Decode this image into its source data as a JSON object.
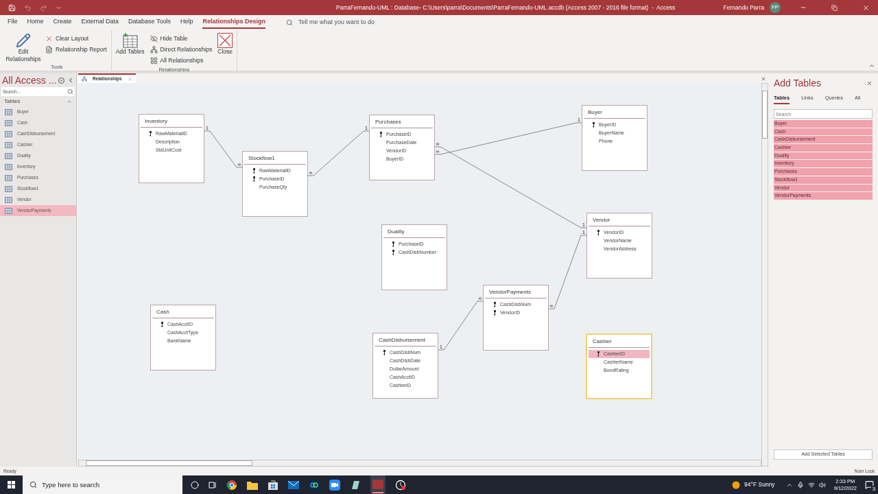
{
  "title_bar": {
    "title": "ParraFernando-UML : Database- C:\\Users\\parra\\Documents\\ParraFernando-UML.accdb (Access 2007 - 2016 file format)  -  Access",
    "user": "Fernando Parra",
    "avatar": "FP"
  },
  "menu_tabs": [
    {
      "label": "File",
      "selected": false
    },
    {
      "label": "Home",
      "selected": false
    },
    {
      "label": "Create",
      "selected": false
    },
    {
      "label": "External Data",
      "selected": false
    },
    {
      "label": "Database Tools",
      "selected": false
    },
    {
      "label": "Help",
      "selected": false
    },
    {
      "label": "Relationships Design",
      "selected": true
    }
  ],
  "tell_me": {
    "placeholder": "Tell me what you want to do"
  },
  "ribbon": {
    "groups": [
      {
        "label": "Tools",
        "buttons": [
          {
            "label": "Edit Relationships",
            "kind": "large"
          },
          {
            "label": "Clear Layout",
            "kind": "small"
          },
          {
            "label": "Relationship Report",
            "kind": "small"
          }
        ]
      },
      {
        "label": "Relationships",
        "buttons": [
          {
            "label": "Add Tables",
            "kind": "large"
          },
          {
            "label": "Hide Table",
            "kind": "small"
          },
          {
            "label": "Direct Relationships",
            "kind": "small"
          },
          {
            "label": "All Relationships",
            "kind": "small"
          },
          {
            "label": "Close",
            "kind": "large"
          }
        ]
      }
    ]
  },
  "nav": {
    "title": "All Access ...",
    "search": {
      "placeholder": "Search..."
    },
    "section": "Tables",
    "items": [
      {
        "label": "Buyer",
        "selected": false
      },
      {
        "label": "Cash",
        "selected": false
      },
      {
        "label": "CashDisbursement",
        "selected": false
      },
      {
        "label": "Cashier",
        "selected": false
      },
      {
        "label": "Duality",
        "selected": false
      },
      {
        "label": "Inventory",
        "selected": false
      },
      {
        "label": "Purchases",
        "selected": false
      },
      {
        "label": "Stockflow1",
        "selected": false
      },
      {
        "label": "Vendor",
        "selected": false
      },
      {
        "label": "VendorPayments",
        "selected": true
      }
    ]
  },
  "document_tab": {
    "label": "Relationships"
  },
  "tables": [
    {
      "name": "Inventory",
      "selected": false,
      "fields": [
        {
          "name": "RawMaterialID",
          "key": true,
          "selected": false
        },
        {
          "name": "Description",
          "key": false,
          "selected": false
        },
        {
          "name": "StdUnitCost",
          "key": false,
          "selected": false
        }
      ]
    },
    {
      "name": "Stockflow1",
      "selected": false,
      "fields": [
        {
          "name": "RawMaterialID",
          "key": true,
          "selected": false
        },
        {
          "name": "PurchaseID",
          "key": true,
          "selected": false
        },
        {
          "name": "PurchaseQty",
          "key": false,
          "selected": false
        }
      ]
    },
    {
      "name": "Purchases",
      "selected": false,
      "fields": [
        {
          "name": "PurchaseID",
          "key": true,
          "selected": false
        },
        {
          "name": "PurchaseDate",
          "key": false,
          "selected": false
        },
        {
          "name": "VendorID",
          "key": false,
          "selected": false
        },
        {
          "name": "BuyerID",
          "key": false,
          "selected": false
        }
      ]
    },
    {
      "name": "Buyer",
      "selected": false,
      "fields": [
        {
          "name": "BuyerID",
          "key": true,
          "selected": false
        },
        {
          "name": "BuyerName",
          "key": false,
          "selected": false
        },
        {
          "name": "Phone",
          "key": false,
          "selected": false
        }
      ]
    },
    {
      "name": "Vendor",
      "selected": false,
      "fields": [
        {
          "name": "VendorID",
          "key": true,
          "selected": false
        },
        {
          "name": "VendorName",
          "key": false,
          "selected": false
        },
        {
          "name": "VendorAddress",
          "key": false,
          "selected": false
        }
      ]
    },
    {
      "name": "Duality",
      "selected": false,
      "fields": [
        {
          "name": "PurchaseID",
          "key": true,
          "selected": false
        },
        {
          "name": "CashDisbNumber",
          "key": true,
          "selected": false
        }
      ]
    },
    {
      "name": "VendorPayments",
      "selected": false,
      "fields": [
        {
          "name": "CashDisbNum",
          "key": true,
          "selected": false
        },
        {
          "name": "VendorID",
          "key": true,
          "selected": false
        }
      ]
    },
    {
      "name": "Cash",
      "selected": false,
      "fields": [
        {
          "name": "CashAcctID",
          "key": true,
          "selected": false
        },
        {
          "name": "CashAcctType",
          "key": false,
          "selected": false
        },
        {
          "name": "BankName",
          "key": false,
          "selected": false
        }
      ]
    },
    {
      "name": "CashDisbursement",
      "selected": false,
      "fields": [
        {
          "name": "CashDisbNum",
          "key": true,
          "selected": false
        },
        {
          "name": "CashDisbDate",
          "key": false,
          "selected": false
        },
        {
          "name": "DollarAmount",
          "key": false,
          "selected": false
        },
        {
          "name": "CashAcctID",
          "key": false,
          "selected": false
        },
        {
          "name": "CashierID",
          "key": false,
          "selected": false
        }
      ]
    },
    {
      "name": "Cashier",
      "selected": true,
      "fields": [
        {
          "name": "CashierID",
          "key": true,
          "selected": true
        },
        {
          "name": "CashierName",
          "key": false,
          "selected": false
        },
        {
          "name": "BondRating",
          "key": false,
          "selected": false
        }
      ]
    }
  ],
  "relationships": [
    {
      "end_a": "1",
      "end_b": "∞"
    },
    {
      "end_a": "∞",
      "end_b": "1"
    },
    {
      "end_a": "∞",
      "end_b": "1"
    },
    {
      "end_a": "∞",
      "end_b": "1"
    },
    {
      "end_a": "1",
      "end_b": "∞"
    },
    {
      "end_a": "∞",
      "end_b": "1"
    }
  ],
  "add_tables": {
    "title": "Add Tables",
    "tabs": [
      {
        "label": "Tables",
        "selected": true
      },
      {
        "label": "Links",
        "selected": false
      },
      {
        "label": "Queries",
        "selected": false
      },
      {
        "label": "All",
        "selected": false
      }
    ],
    "search": {
      "placeholder": "Search"
    },
    "items": [
      {
        "label": "Buyer",
        "selected": true
      },
      {
        "label": "Cash",
        "selected": true
      },
      {
        "label": "CashDisbursement",
        "selected": true
      },
      {
        "label": "Cashier",
        "selected": true
      },
      {
        "label": "Duality",
        "selected": true
      },
      {
        "label": "Inventory",
        "selected": true
      },
      {
        "label": "Purchases",
        "selected": true
      },
      {
        "label": "Stockflow1",
        "selected": true
      },
      {
        "label": "Vendor",
        "selected": true
      },
      {
        "label": "VendorPayments",
        "selected": true
      }
    ],
    "button": "Add Selected Tables"
  },
  "status_bar": {
    "left": "Ready",
    "right": "Num Lock"
  },
  "taskbar": {
    "search": {
      "placeholder": "Type here to search"
    },
    "weather": "94°F Sunny",
    "time": "2:33 PM",
    "date": "9/12/2022",
    "notifications": "3"
  }
}
